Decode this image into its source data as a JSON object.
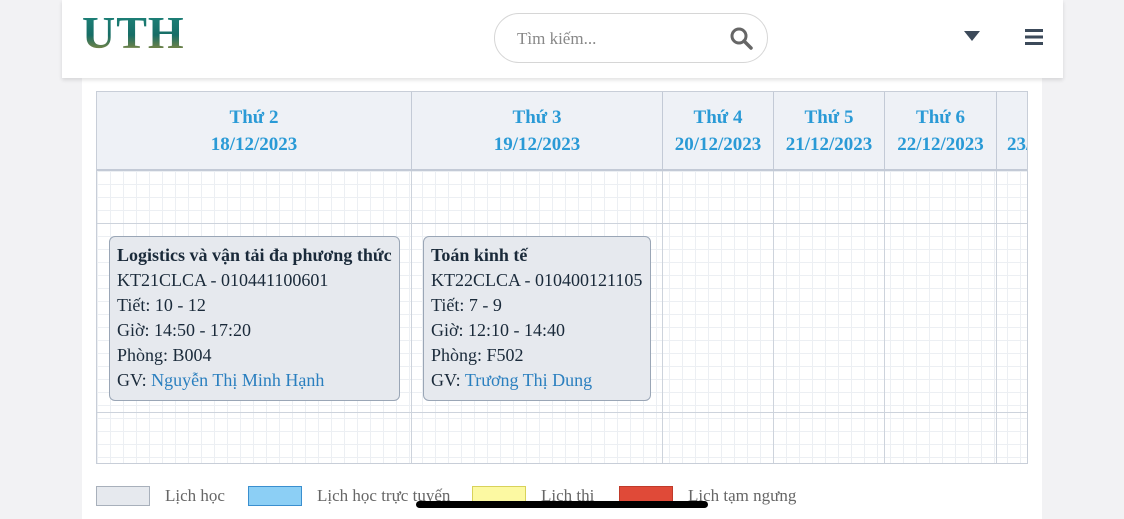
{
  "header": {
    "logo_text": "UTH",
    "search_placeholder": "Tìm kiếm...",
    "icons": [
      "search-icon",
      "caret-down-icon",
      "hamburger-menu-icon"
    ]
  },
  "schedule": {
    "days": [
      {
        "name": "Thứ 2",
        "date": "18/12/2023"
      },
      {
        "name": "Thứ 3",
        "date": "19/12/2023"
      },
      {
        "name": "Thứ 4",
        "date": "20/12/2023"
      },
      {
        "name": "Thứ 5",
        "date": "21/12/2023"
      },
      {
        "name": "Thứ 6",
        "date": "22/12/2023"
      },
      {
        "name": "",
        "date": "23/"
      }
    ],
    "events": [
      {
        "title": "Logistics và vận tải đa phương thức",
        "code": "KT21CLCA - 010441100601",
        "period": "Tiết: 10 - 12",
        "time": "Giờ: 14:50 - 17:20",
        "room": "Phòng: B004",
        "lecturer_label": "GV: ",
        "lecturer": "Nguyễn Thị Minh Hạnh"
      },
      {
        "title": "Toán kinh tế",
        "code": "KT22CLCA - 010400121105",
        "period": "Tiết: 7 - 9",
        "time": "Giờ: 12:10 - 14:40",
        "room": "Phòng: F502",
        "lecturer_label": "GV: ",
        "lecturer": "Trương Thị Dung"
      }
    ]
  },
  "legend": [
    {
      "label": "Lịch học",
      "color": "#e6e9ee"
    },
    {
      "label": "Lịch học trực tuyến",
      "color": "#8ccff5"
    },
    {
      "label": "Lịch thi",
      "color": "#fcf9a2"
    },
    {
      "label": "Lịch tạm ngưng",
      "color": "#e04a38"
    }
  ],
  "colors": {
    "accent": "#2a9ad6",
    "logo": "#1a7a72"
  }
}
